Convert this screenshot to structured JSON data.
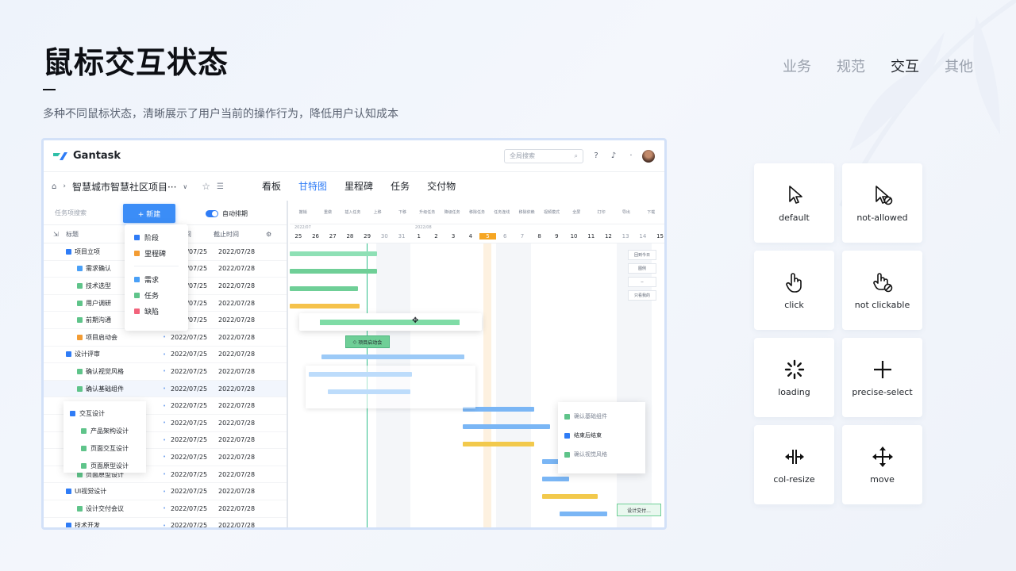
{
  "page": {
    "title": "鼠标交互状态",
    "subtitle": "多种不同鼠标状态，清晰展示了用户当前的操作行为，降低用户认知成本",
    "nav": [
      "业务",
      "规范",
      "交互",
      "其他"
    ],
    "nav_active": 2
  },
  "app": {
    "logo": "Gantask",
    "search_placeholder": "全局搜索",
    "project_name": "智慧城市智慧社区项目···",
    "tabs": [
      "看板",
      "甘特图",
      "里程碑",
      "任务",
      "交付物"
    ],
    "tab_active": 1,
    "task_search_placeholder": "任务项搜索",
    "new_button": "+ 新建",
    "auto_schedule": "自动排期",
    "columns": [
      "标题",
      "开始时间",
      "截止时间"
    ],
    "new_menu": [
      "阶段",
      "里程碑",
      "需求",
      "任务",
      "缺陷"
    ],
    "rows": [
      {
        "title": "项目立项",
        "start": "2022/07/25",
        "end": "2022/07/28"
      },
      {
        "title": "需求确认",
        "start": "2022/07/25",
        "end": "2022/07/28"
      },
      {
        "title": "技术选型",
        "start": "2022/07/25",
        "end": "2022/07/28"
      },
      {
        "title": "用户调研",
        "start": "2022/07/25",
        "end": "2022/07/28"
      },
      {
        "title": "前期沟通",
        "start": "2022/07/25",
        "end": "2022/07/28"
      },
      {
        "title": "项目启动会",
        "start": "2022/07/25",
        "end": "2022/07/28"
      },
      {
        "title": "设计评审",
        "start": "2022/07/25",
        "end": "2022/07/28"
      },
      {
        "title": "确认视觉风格",
        "start": "2022/07/25",
        "end": "2022/07/28"
      },
      {
        "title": "确认基础组件",
        "start": "2022/07/25",
        "end": "2022/07/28"
      },
      {
        "title": "交互设计",
        "start": "2022/07/25",
        "end": "2022/07/28"
      },
      {
        "title": "产品架构设计",
        "start": "2022/07/25",
        "end": "2022/07/28"
      },
      {
        "title": "页面交互设计",
        "start": "2022/07/25",
        "end": "2022/07/28"
      },
      {
        "title": "页面原型设计",
        "start": "2022/07/25",
        "end": "2022/07/28"
      },
      {
        "title": "页面原型设计",
        "start": "2022/07/25",
        "end": "2022/07/28"
      },
      {
        "title": "UI视觉设计",
        "start": "2022/07/25",
        "end": "2022/07/28"
      },
      {
        "title": "设计交付会议",
        "start": "2022/07/25",
        "end": "2022/07/28"
      },
      {
        "title": "技术开发",
        "start": "2022/07/25",
        "end": "2022/07/28"
      }
    ],
    "drag_panel": [
      "交互设计",
      "产品架构设计",
      "页面交互设计",
      "页面原型设计"
    ],
    "gantt_toolbar": [
      "撤销",
      "重做",
      "插入任务",
      "上移",
      "下移",
      "升级任务",
      "降级任务",
      "移除任务",
      "任务连线",
      "移除依赖",
      "视频模式",
      "全屏",
      "打印",
      "导出",
      "下载"
    ],
    "month_labels": [
      "2022/07",
      "2022/08"
    ],
    "days": [
      "25",
      "26",
      "27",
      "28",
      "29",
      "30",
      "31",
      "1",
      "2",
      "3",
      "4",
      "5",
      "6",
      "7",
      "8",
      "9",
      "10",
      "11",
      "12",
      "13",
      "14",
      "15"
    ],
    "today_index": 11,
    "milestone_label": "项目启动会",
    "dependency_popup": [
      "确认基础组件",
      "结束后结束",
      "确认视觉风格"
    ],
    "side_buttons": [
      "回到今日",
      "图例",
      "只看我的"
    ],
    "delivery_label": "设计交付..."
  },
  "cursors": [
    {
      "label": "default",
      "icon": "arrow-cursor-icon"
    },
    {
      "label": "not-allowed",
      "icon": "not-allowed-cursor-icon"
    },
    {
      "label": "click",
      "icon": "hand-cursor-icon"
    },
    {
      "label": "not clickable",
      "icon": "hand-blocked-cursor-icon"
    },
    {
      "label": "loading",
      "icon": "loading-spinner-icon"
    },
    {
      "label": "precise-select",
      "icon": "crosshair-icon"
    },
    {
      "label": "col-resize",
      "icon": "col-resize-icon"
    },
    {
      "label": "move",
      "icon": "move-arrows-icon"
    }
  ]
}
